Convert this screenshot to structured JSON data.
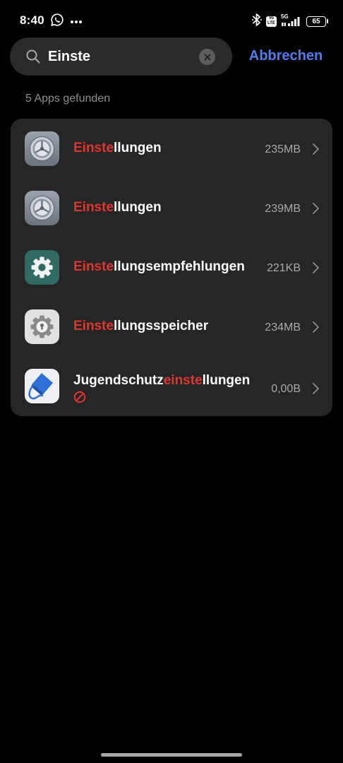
{
  "status_bar": {
    "time": "8:40",
    "icons": [
      "whatsapp-icon",
      "more-dots-icon",
      "bluetooth-icon",
      "volte-icon",
      "signal-5g-icon",
      "battery-icon"
    ],
    "volte_top": "Vo",
    "volte_bottom": "LTE",
    "network": "5G",
    "battery": "65"
  },
  "search": {
    "value": "Einste",
    "cancel_label": "Abbrechen"
  },
  "results": {
    "count_label": "5 Apps gefunden",
    "highlight_color": "#e2352d",
    "apps": [
      {
        "name_pre": "",
        "name_hl": "Einste",
        "name_post": "llungen",
        "size": "235MB",
        "icon": "settings-gear-icon",
        "blocked": false
      },
      {
        "name_pre": "",
        "name_hl": "Einste",
        "name_post": "llungen",
        "size": "239MB",
        "icon": "settings-gear-icon",
        "blocked": false
      },
      {
        "name_pre": "",
        "name_hl": "Einste",
        "name_post": "llungsempfehlungen",
        "size": "221KB",
        "icon": "teal-gear-icon",
        "blocked": false
      },
      {
        "name_pre": "",
        "name_hl": "Einste",
        "name_post": "llungsspeicher",
        "size": "234MB",
        "icon": "lock-gear-icon",
        "blocked": false
      },
      {
        "name_pre": "Jugendschutz",
        "name_hl": "einste",
        "name_post": "llungen",
        "size": "0,00B",
        "icon": "parental-control-icon",
        "blocked": true
      }
    ]
  },
  "colors": {
    "background": "#000000",
    "search_field": "#2b2b2b",
    "card": "#262626",
    "accent": "#4f7cf0",
    "muted_text": "#8d8d8d"
  }
}
